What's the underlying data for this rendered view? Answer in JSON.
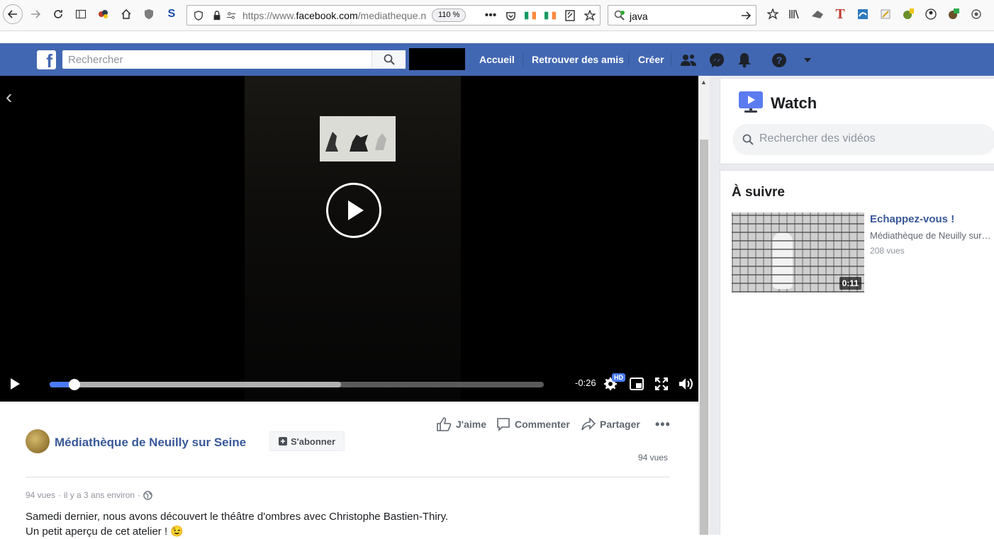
{
  "browser": {
    "url_prefix": "https://www.",
    "url_domain": "facebook.com",
    "url_rest": "/mediatheque.n",
    "zoom": "110 %",
    "search_value": "java"
  },
  "fb": {
    "search_placeholder": "Rechercher",
    "nav": [
      "Accueil",
      "Retrouver des amis",
      "Créer"
    ]
  },
  "video": {
    "time_left": "-0:26",
    "hd": "HD",
    "progress_fraction": 0.03,
    "buffered_fraction": 0.59
  },
  "post": {
    "actions": {
      "like": "J'aime",
      "comment": "Commenter",
      "share": "Partager"
    },
    "page_name": "Médiathèque de Neuilly sur Seine",
    "subscribe": "S'abonner",
    "views_right": "94 vues",
    "meta_views": "94 vues",
    "meta_time": "il y a 3 ans environ",
    "desc_line1": "Samedi dernier, nous avons découvert le théâtre d'ombres avec Christophe Bastien-Thiry.",
    "desc_line2": "Un petit aperçu de cet atelier ! 😉"
  },
  "watch": {
    "title": "Watch",
    "search_placeholder": "Rechercher des vidéos",
    "next_title": "À suivre",
    "item": {
      "title": "Echappez-vous !",
      "page": "Médiathèque de Neuilly sur Seine",
      "views": "208 vues",
      "duration": "0:11"
    }
  },
  "colors": {
    "fb_blue": "#4267b2",
    "link": "#385898",
    "progress": "#4a7cf7"
  }
}
